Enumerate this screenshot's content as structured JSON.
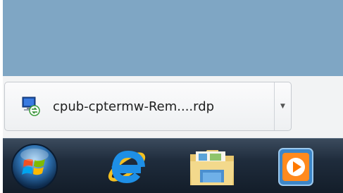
{
  "download_bar": {
    "file_name": "cpub-cptermw-Rem....rdp",
    "file_icon": "remote-desktop-file-icon",
    "options_icon": "chevron-down-icon"
  },
  "taskbar": {
    "start_button_icon": "windows-start-orb-icon",
    "pinned": [
      {
        "name": "internet-explorer",
        "icon": "internet-explorer-icon"
      },
      {
        "name": "windows-explorer",
        "icon": "folder-library-icon"
      },
      {
        "name": "windows-media-player",
        "icon": "media-player-icon"
      }
    ]
  },
  "colors": {
    "desktop_background": "#7fa6c4",
    "taskbar": "#1f2c3c"
  }
}
